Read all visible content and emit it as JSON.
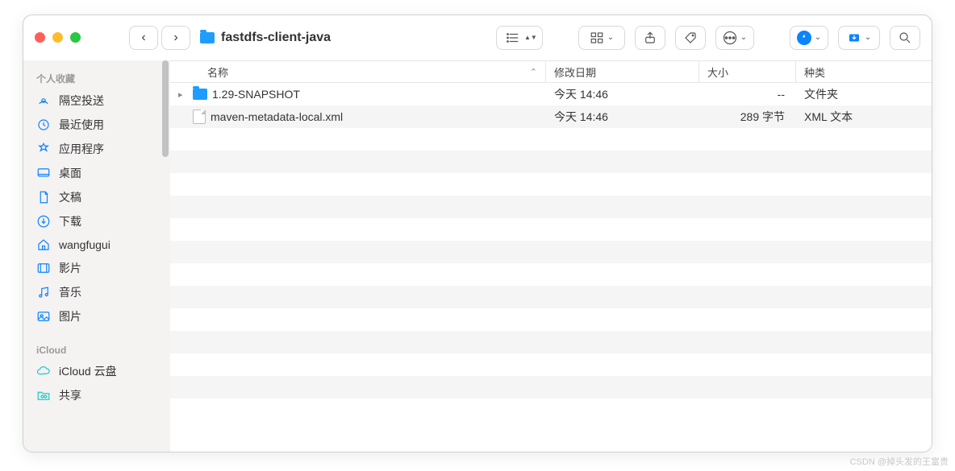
{
  "window": {
    "title": "fastdfs-client-java"
  },
  "columns": {
    "name": "名称",
    "date": "修改日期",
    "size": "大小",
    "kind": "种类"
  },
  "sidebar": {
    "favorites_title": "个人收藏",
    "icloud_title": "iCloud",
    "items": [
      {
        "label": "隔空投送"
      },
      {
        "label": "最近使用"
      },
      {
        "label": "应用程序"
      },
      {
        "label": "桌面"
      },
      {
        "label": "文稿"
      },
      {
        "label": "下载"
      },
      {
        "label": "wangfugui"
      },
      {
        "label": "影片"
      },
      {
        "label": "音乐"
      },
      {
        "label": "图片"
      }
    ],
    "icloud_items": [
      {
        "label": "iCloud 云盘"
      },
      {
        "label": "共享"
      }
    ]
  },
  "rows": [
    {
      "name": "1.29-SNAPSHOT",
      "date": "今天 14:46",
      "size": "--",
      "kind": "文件夹",
      "type": "folder",
      "expandable": true
    },
    {
      "name": "maven-metadata-local.xml",
      "date": "今天 14:46",
      "size": "289 字节",
      "kind": "XML 文本",
      "type": "file",
      "expandable": false
    }
  ],
  "watermark": "CSDN @掉头发的王富贵"
}
